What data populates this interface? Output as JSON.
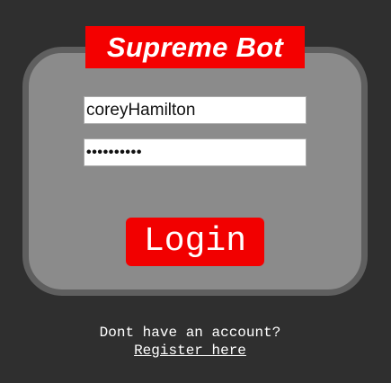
{
  "brand": {
    "title": "Supreme Bot",
    "background_color": "#f40000",
    "text_color": "#ffffff"
  },
  "form": {
    "username_value": "coreyHamilton",
    "password_value": "••••••••••",
    "login_label": "Login",
    "login_button_color": "#f20000",
    "card_color": "#8b8b8b",
    "card_border_color": "#5f5f5f"
  },
  "footer": {
    "question": "Dont have an account?",
    "register_link": "Register here"
  },
  "page": {
    "background_color": "#2f2f2f"
  }
}
